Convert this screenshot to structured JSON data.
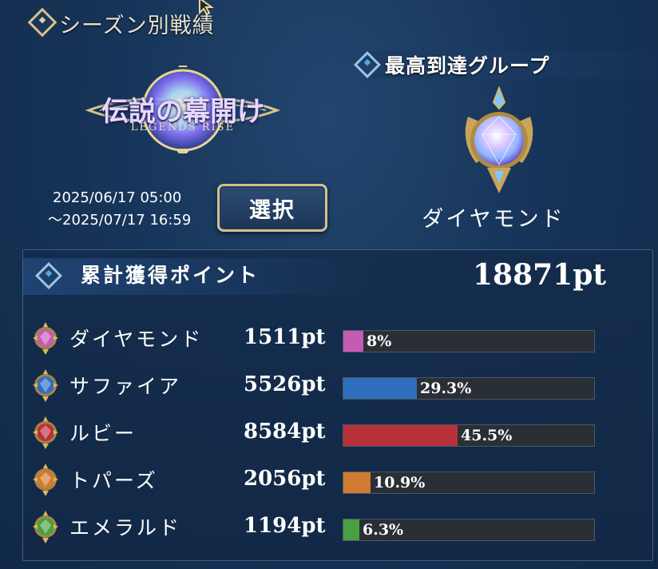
{
  "header": {
    "title": "シーズン別戦績"
  },
  "season": {
    "logo_title": "伝説の幕開け",
    "logo_subtitle": "LEGENDS RISE",
    "start": "2025/06/17 05:00",
    "end": "〜2025/07/17 16:59",
    "select_label": "選択"
  },
  "top_group": {
    "title": "最高到達グループ",
    "name": "ダイヤモンド"
  },
  "points": {
    "title": "累計獲得ポイント",
    "total": "18871pt",
    "rows": [
      {
        "name": "ダイヤモンド",
        "points": "1511pt",
        "percent_label": "8%",
        "fraction": 0.08,
        "color": "#c45bb4",
        "icon": "diamond-gem-icon"
      },
      {
        "name": "サファイア",
        "points": "5526pt",
        "percent_label": "29.3%",
        "fraction": 0.293,
        "color": "#2f6fc0",
        "icon": "sapphire-gem-icon"
      },
      {
        "name": "ルビー",
        "points": "8584pt",
        "percent_label": "45.5%",
        "fraction": 0.455,
        "color": "#b8313a",
        "icon": "ruby-gem-icon"
      },
      {
        "name": "トパーズ",
        "points": "2056pt",
        "percent_label": "10.9%",
        "fraction": 0.109,
        "color": "#d07a32",
        "icon": "topaz-gem-icon"
      },
      {
        "name": "エメラルド",
        "points": "1194pt",
        "percent_label": "6.3%",
        "fraction": 0.063,
        "color": "#4aa040",
        "icon": "emerald-gem-icon"
      }
    ]
  }
}
